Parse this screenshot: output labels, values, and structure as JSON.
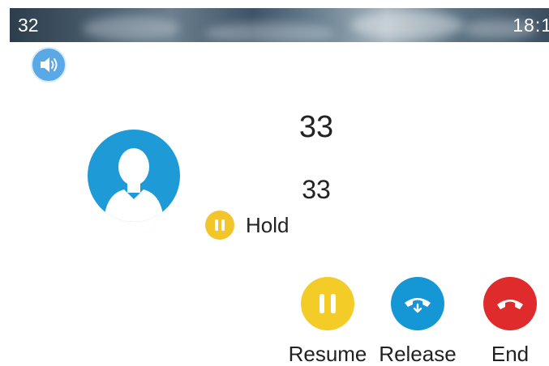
{
  "status_bar": {
    "account": "32",
    "time": "18:1"
  },
  "call": {
    "name": "33",
    "number": "33",
    "state": "Hold"
  },
  "softkeys": {
    "resume": "Resume",
    "release": "Release",
    "end": "End"
  },
  "colors": {
    "speaker": "#5aa9e6",
    "avatar": "#1e9ad6",
    "hold": "#f2c52a",
    "resume": "#f4cc27",
    "release": "#1597d5",
    "end": "#df2b2b"
  },
  "icons": {
    "speaker": "speaker-icon",
    "avatar": "contact-avatar-icon",
    "hold": "pause-icon",
    "resume": "pause-icon",
    "release": "handset-transfer-icon",
    "end": "handset-down-icon"
  }
}
